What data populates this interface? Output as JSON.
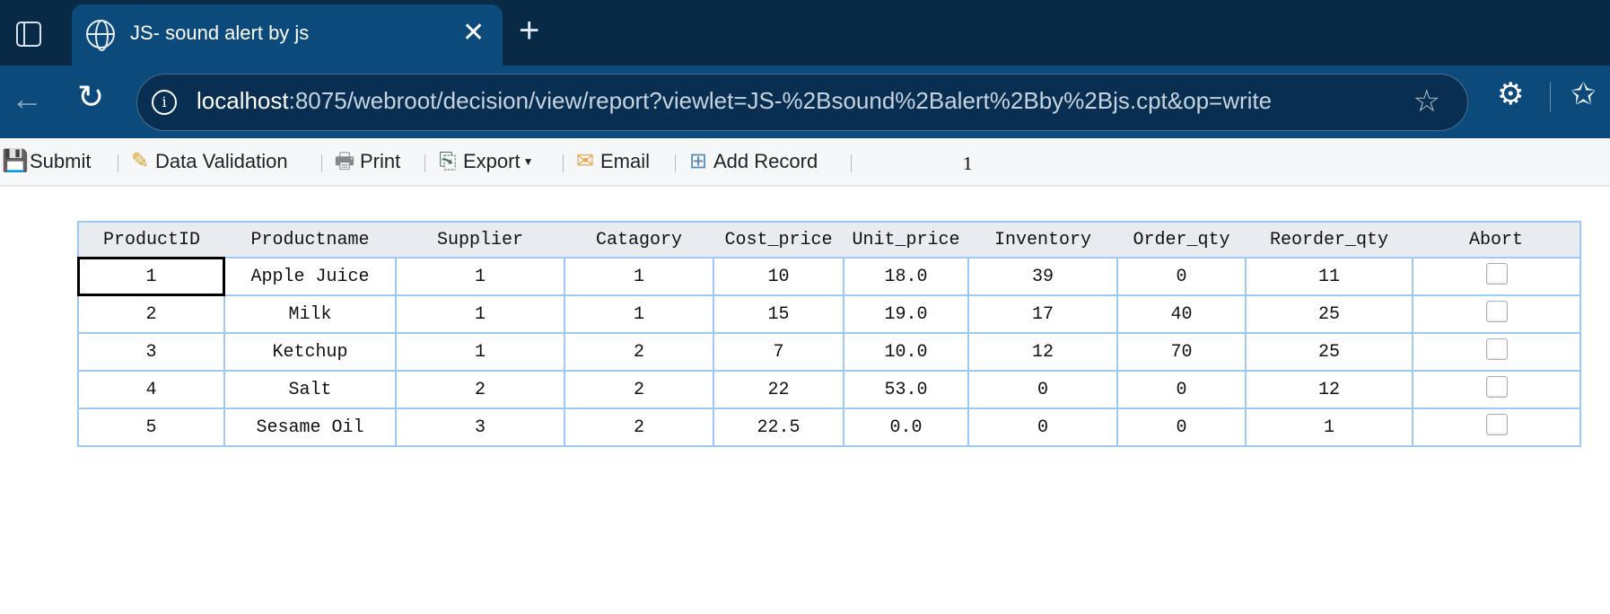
{
  "browser": {
    "tab_title": "JS- sound alert by js",
    "url_host": "localhost",
    "url_rest": ":8075/webroot/decision/view/report?viewlet=JS-%2Bsound%2Balert%2Bby%2Bjs.cpt&op=write"
  },
  "toolbar": {
    "submit": "Submit",
    "validation": "Data Validation",
    "print": "Print",
    "export": "Export",
    "email": "Email",
    "add_record": "Add Record",
    "page": "1"
  },
  "table": {
    "headers": [
      "ProductID",
      "Productname",
      "Supplier",
      "Catagory",
      "Cost_price",
      "Unit_price",
      "Inventory",
      "Order_qty",
      "Reorder_qty",
      "Abort"
    ],
    "rows": [
      [
        "1",
        "Apple Juice",
        "1",
        "1",
        "10",
        "18.0",
        "39",
        "0",
        "11"
      ],
      [
        "2",
        "Milk",
        "1",
        "1",
        "15",
        "19.0",
        "17",
        "40",
        "25"
      ],
      [
        "3",
        "Ketchup",
        "1",
        "2",
        "7",
        "10.0",
        "12",
        "70",
        "25"
      ],
      [
        "4",
        "Salt",
        "2",
        "2",
        "22",
        "53.0",
        "0",
        "0",
        "12"
      ],
      [
        "5",
        "Sesame Oil",
        "3",
        "2",
        "22.5",
        "0.0",
        "0",
        "0",
        "1"
      ]
    ]
  }
}
